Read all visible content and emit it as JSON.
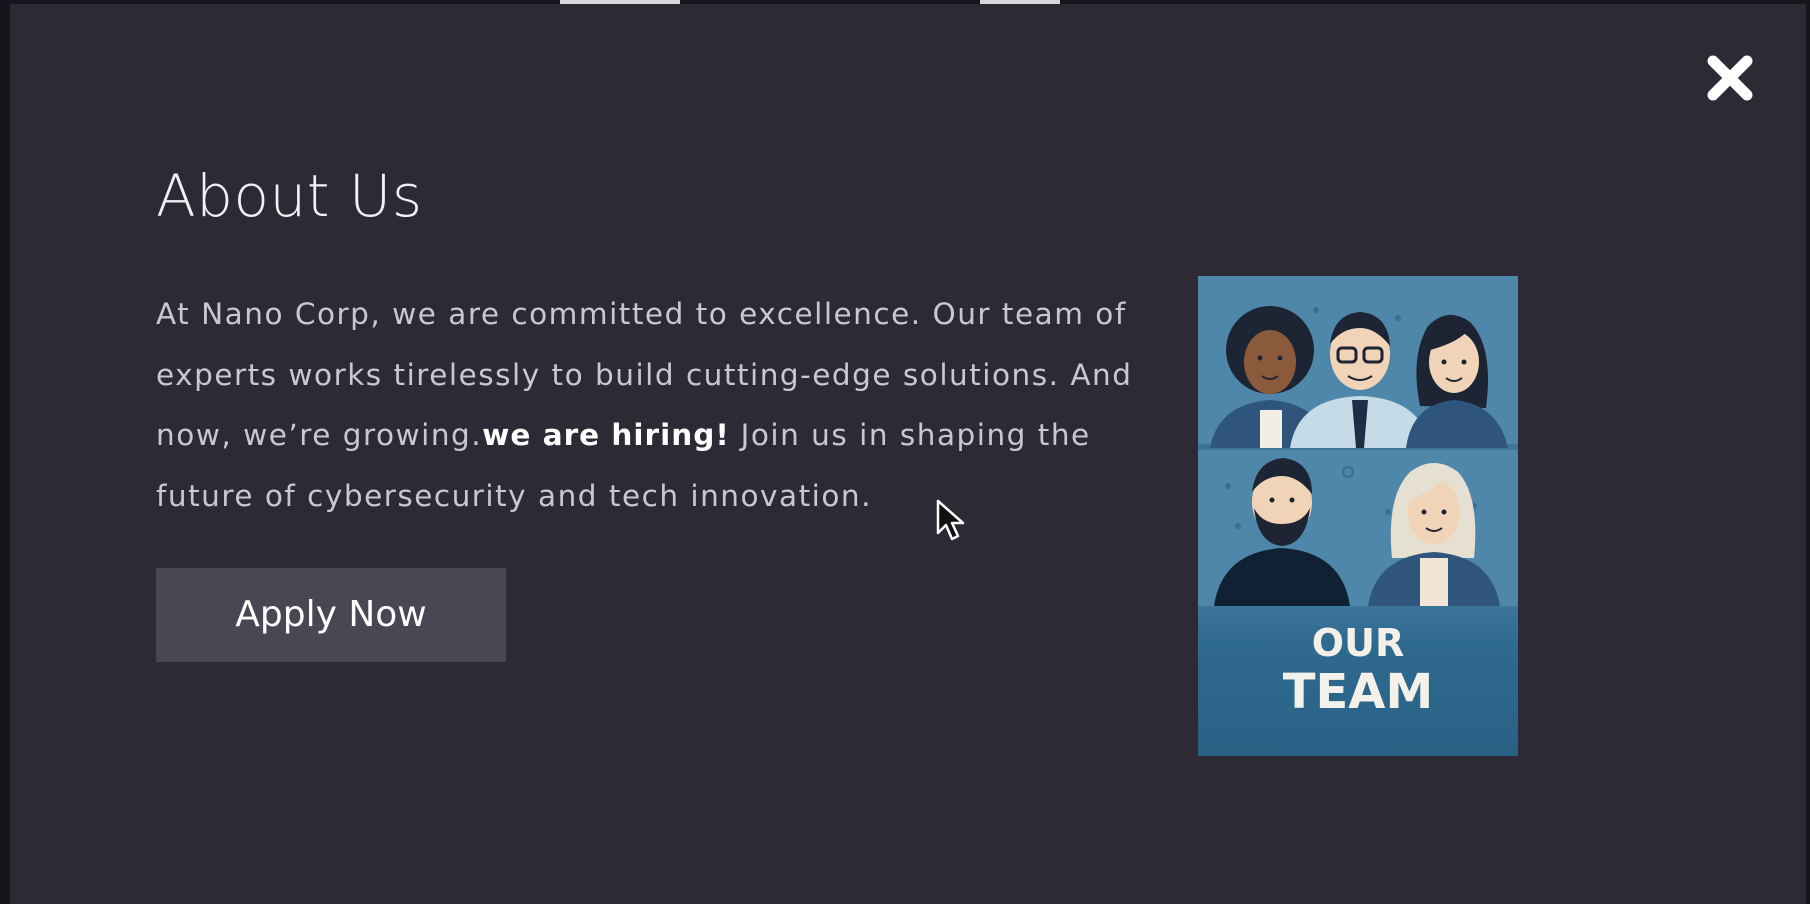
{
  "modal": {
    "title": "About Us",
    "paragraph_part1": "At Nano Corp, we are committed to excellence. Our team of experts works tirelessly to build cutting-edge solutions. And now, we’re growing.",
    "paragraph_highlight": "we are hiring!",
    "paragraph_part2": " Join us in shaping the future of cybersecurity and tech innovation.",
    "apply_label": "Apply Now",
    "close_icon": "close-icon",
    "image": {
      "caption_line1": "OUR",
      "caption_line2": "TEAM",
      "icon": "team-illustration"
    }
  },
  "colors": {
    "modal_bg": "#2d2a36",
    "button_bg": "#4a4653",
    "image_bg": "#4f87aa",
    "image_caption_bg": "#2c6589"
  }
}
